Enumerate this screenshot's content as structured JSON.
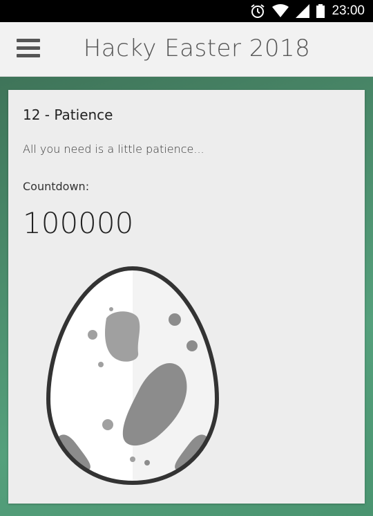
{
  "status_bar": {
    "time": "23:00",
    "icons": [
      "alarm-icon",
      "wifi-icon",
      "signal-icon",
      "battery-icon"
    ]
  },
  "app_bar": {
    "title": "Hacky Easter 2018",
    "menu_icon": "hamburger-menu-icon"
  },
  "challenge": {
    "title": "12 - Patience",
    "description": "All you need is a little patience...",
    "countdown_label": "Countdown:",
    "countdown_value": "100000"
  },
  "colors": {
    "status_bar_bg": "#000000",
    "app_bar_bg": "#f2f2f2",
    "card_bg": "#ededed",
    "background_green": "#4a8a6a"
  }
}
